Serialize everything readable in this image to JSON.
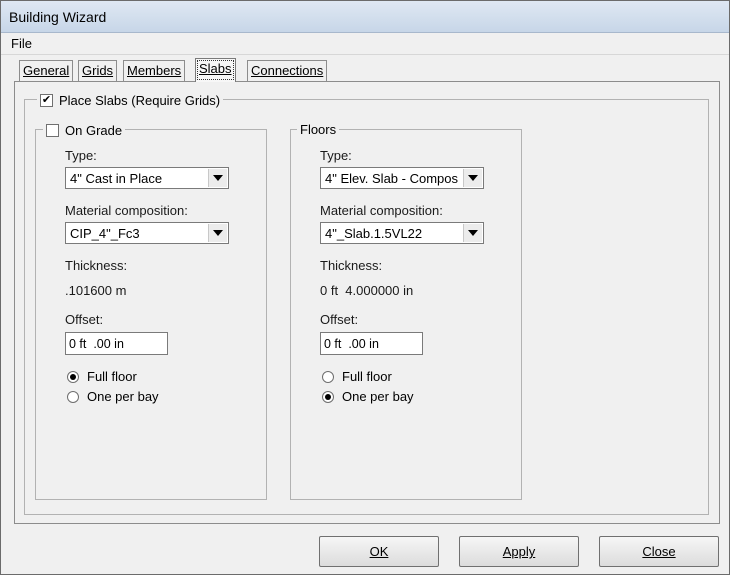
{
  "window": {
    "title": "Building Wizard"
  },
  "menu": {
    "file": "File"
  },
  "tabs": [
    {
      "label": "General"
    },
    {
      "label": "Grids"
    },
    {
      "label": "Members"
    },
    {
      "label": "Slabs"
    },
    {
      "label": "Connections"
    }
  ],
  "place_slabs": {
    "label": "Place Slabs (Require Grids)",
    "checked": true
  },
  "on_grade": {
    "legend": "On Grade",
    "checked": false,
    "type_label": "Type:",
    "type_value": "4\" Cast in Place",
    "material_label": "Material composition:",
    "material_value": "CIP_4\"_Fc3",
    "thickness_label": "Thickness:",
    "thickness_value": ".101600 m",
    "offset_label": "Offset:",
    "offset_value": "0 ft  .00 in",
    "radio_full": "Full floor",
    "radio_bay": "One per bay",
    "selected": "full"
  },
  "floors": {
    "legend": "Floors",
    "type_label": "Type:",
    "type_value": "4\" Elev. Slab - Compos",
    "material_label": "Material composition:",
    "material_value": "4\"_Slab.1.5VL22",
    "thickness_label": "Thickness:",
    "thickness_value": "0 ft  4.000000 in",
    "offset_label": "Offset:",
    "offset_value": "0 ft  .00 in",
    "radio_full": "Full floor",
    "radio_bay": "One per bay",
    "selected": "bay"
  },
  "buttons": {
    "ok": "OK",
    "apply": "Apply",
    "close": "Close"
  },
  "icons": {
    "check": "checkmark-icon",
    "dropdown": "chevron-down-icon"
  }
}
